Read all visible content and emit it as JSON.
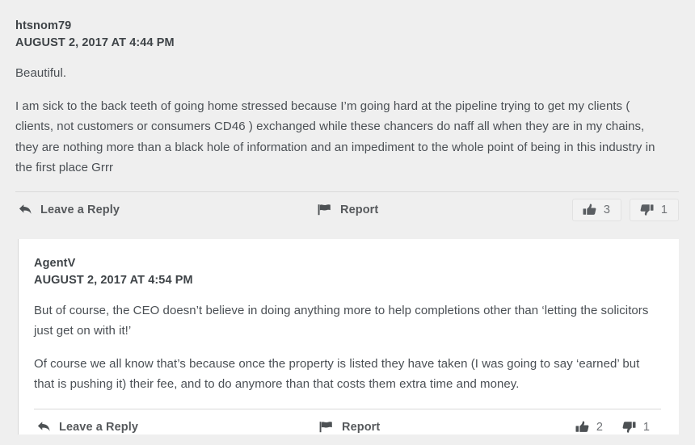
{
  "theme": {
    "page_bg": "#efefef",
    "reply_bg": "#ffffff",
    "text_color": "#3f4448",
    "muted_text": "#6a6e72",
    "divider": "#d9d9d9"
  },
  "comment": {
    "author": "htsnom79",
    "timestamp": "AUGUST 2, 2017 AT 4:44 PM",
    "paragraphs": [
      "Beautiful.",
      "I am sick to the back teeth of going home stressed because I’m going hard at the pipeline trying to get my clients ( clients, not customers or consumers CD46 ) exchanged while these chancers do naff all when they are in my chains, they are nothing more than a black hole of information and an impediment  to the whole point of being in this industry in the first place Grrr"
    ],
    "actions": {
      "reply_label": "Leave a Reply",
      "reply_icon": "reply-arrow-icon",
      "report_label": "Report",
      "report_icon": "flag-icon",
      "upvote_icon": "thumbs-up-icon",
      "upvote_count": "3",
      "downvote_icon": "thumbs-down-icon",
      "downvote_count": "1"
    }
  },
  "reply": {
    "author": "AgentV",
    "timestamp": "AUGUST 2, 2017 AT 4:54 PM",
    "paragraphs": [
      "But of course, the CEO doesn’t believe in doing anything more to help completions other than ‘letting the solicitors just get on with it!’",
      "Of course we all know that’s because once the property is listed they have taken (I was going to say ‘earned’ but that is pushing it) their fee, and to do anymore than that costs them extra time and money."
    ],
    "actions": {
      "reply_label": "Leave a Reply",
      "reply_icon": "reply-arrow-icon",
      "report_label": "Report",
      "report_icon": "flag-icon",
      "upvote_icon": "thumbs-up-icon",
      "upvote_count": "2",
      "downvote_icon": "thumbs-down-icon",
      "downvote_count": "1"
    }
  }
}
